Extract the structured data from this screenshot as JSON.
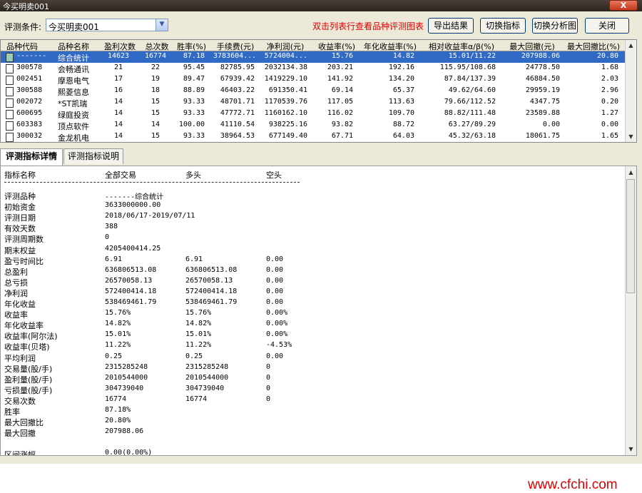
{
  "window": {
    "title": "今买明卖001",
    "close_label": "X"
  },
  "toolbar": {
    "condition_label": "评测条件:",
    "condition_value": "今买明卖001",
    "hint": "双击列表行查看品种评测图表",
    "buttons": {
      "export": "导出结果",
      "switch_indicator": "切换指标",
      "switch_analysis": "切换分析图",
      "close": "关闭"
    }
  },
  "grid": {
    "headers": [
      "品种代码",
      "品种名称",
      "盈利次数",
      "总次数",
      "胜率(%)",
      "手续费(元)",
      "净利润(元)",
      "收益率(%)",
      "年化收益率(%)",
      "相对收益率α/β(%)",
      "最大回撤(元)",
      "最大回撤比(%)"
    ],
    "rows": [
      [
        "-------",
        "综合统计",
        "14623",
        "16774",
        "87.18",
        "3783604...",
        "5724004...",
        "15.76",
        "14.82",
        "15.01/11.22",
        "207988.06",
        "20.80"
      ],
      [
        "300578",
        "会畅通讯",
        "21",
        "22",
        "95.45",
        "82785.95",
        "2032134.38",
        "203.21",
        "192.16",
        "115.95/108.68",
        "24778.50",
        "1.68"
      ],
      [
        "002451",
        "摩恩电气",
        "17",
        "19",
        "89.47",
        "67939.42",
        "1419229.10",
        "141.92",
        "134.20",
        "87.84/137.39",
        "46884.50",
        "2.03"
      ],
      [
        "300588",
        "熙菱信息",
        "16",
        "18",
        "88.89",
        "46403.22",
        "691350.41",
        "69.14",
        "65.37",
        "49.62/64.60",
        "29959.19",
        "2.96"
      ],
      [
        "002072",
        "*ST凯瑞",
        "14",
        "15",
        "93.33",
        "48701.71",
        "1170539.76",
        "117.05",
        "113.63",
        "79.66/112.52",
        "4347.75",
        "0.20"
      ],
      [
        "600695",
        "绿庭投资",
        "14",
        "15",
        "93.33",
        "47772.71",
        "1160162.10",
        "116.02",
        "109.70",
        "88.82/111.48",
        "23589.88",
        "1.27"
      ],
      [
        "603383",
        "顶点软件",
        "14",
        "14",
        "100.00",
        "41110.54",
        "938225.16",
        "93.82",
        "88.72",
        "63.27/89.29",
        "0.00",
        "0.00"
      ],
      [
        "300032",
        "金龙机电",
        "14",
        "15",
        "93.33",
        "38964.53",
        "677149.40",
        "67.71",
        "64.03",
        "45.32/63.18",
        "18061.75",
        "1.65"
      ]
    ]
  },
  "tabs": {
    "detail": "评测指标详情",
    "explain": "评测指标说明"
  },
  "detail": {
    "headers": [
      "指标名称",
      "全部交易",
      "多头",
      "空头"
    ],
    "rows": [
      [
        "评测品种",
        "-------综合统计",
        "",
        ""
      ],
      [
        "初始资金",
        "3633000000.00",
        "",
        ""
      ],
      [
        "评测日期",
        "2018/06/17-2019/07/11",
        "",
        ""
      ],
      [
        "有效天数",
        "388",
        "",
        ""
      ],
      [
        "评测周期数",
        "0",
        "",
        ""
      ],
      [
        "期末权益",
        "4205400414.25",
        "",
        ""
      ],
      [
        "盈亏时间比",
        "6.91",
        "6.91",
        "0.00"
      ],
      [
        "总盈利",
        "636806513.08",
        "636806513.08",
        "0.00"
      ],
      [
        "总亏损",
        "26570058.13",
        "26570058.13",
        "0.00"
      ],
      [
        "净利润",
        "572400414.18",
        "572400414.18",
        "0.00"
      ],
      [
        "年化收益",
        "538469461.79",
        "538469461.79",
        "0.00"
      ],
      [
        "收益率",
        "15.76%",
        "15.76%",
        "0.00%"
      ],
      [
        "年化收益率",
        "14.82%",
        "14.82%",
        "0.00%"
      ],
      [
        "收益率(阿尔法)",
        "15.01%",
        "15.01%",
        "0.00%"
      ],
      [
        "收益率(贝塔)",
        "11.22%",
        "11.22%",
        "-4.53%"
      ],
      [
        "平均利润",
        "0.25",
        "0.25",
        "0.00"
      ],
      [
        "交易量(股/手)",
        "2315285248",
        "2315285248",
        "0"
      ],
      [
        "盈利量(股/手)",
        "2010544000",
        "2010544000",
        "0"
      ],
      [
        "亏损量(股/手)",
        "304739040",
        "304739040",
        "0"
      ],
      [
        "交易次数",
        "16774",
        "16774",
        "0"
      ],
      [
        "胜率",
        "87.18%",
        "",
        ""
      ],
      [
        "最大回撤比",
        "20.80%",
        "",
        ""
      ],
      [
        "最大回撤",
        "207988.06",
        "",
        ""
      ],
      [
        "",
        "",
        " ",
        ""
      ],
      [
        "区间涨幅",
        "0.00(0.00%)",
        "",
        ""
      ]
    ]
  },
  "watermark": "www.cfchi.com"
}
